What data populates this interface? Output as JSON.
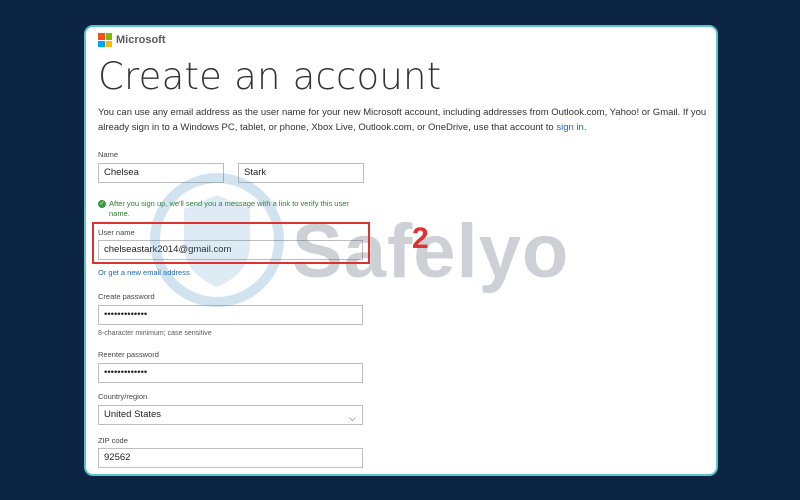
{
  "brand": "Microsoft",
  "title": "Create an account",
  "intro": {
    "text": "You can use any email address as the user name for your new Microsoft account, including addresses from Outlook.com, Yahoo! or Gmail. If you already sign in to a Windows PC, tablet, or phone, Xbox Live, Outlook.com, or OneDrive, use that account to ",
    "link": "sign in",
    "end": "."
  },
  "name_section": {
    "label": "Name",
    "first": "Chelsea",
    "last": "Stark"
  },
  "verify_notice": "After you sign up, we'll send you a message with a link to verify this user name.",
  "username": {
    "label": "User name",
    "value": "chelseastark2014@gmail.com",
    "alt_link": "Or get a new email address"
  },
  "password": {
    "label": "Create password",
    "value": "•••••••••••••",
    "hint": "8-character minimum; case sensitive"
  },
  "reenter": {
    "label": "Reenter password",
    "value": "•••••••••••••"
  },
  "country": {
    "label": "Country/region",
    "value": "United States"
  },
  "zip": {
    "label": "ZIP code",
    "value": "92562"
  },
  "annotation": {
    "step": "2",
    "watermark": "Safelyo",
    "color": "#e03131"
  },
  "colors": {
    "background": "#0d2544",
    "card_border": "#5fc3c9",
    "link": "#2368b7"
  }
}
